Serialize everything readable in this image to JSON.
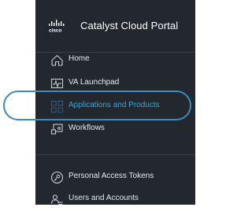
{
  "brand": {
    "logo_text": "cisco",
    "title": "Catalyst Cloud Portal"
  },
  "nav": {
    "items": [
      {
        "label": "Home",
        "icon": "home-icon"
      },
      {
        "label": "VA Launchpad",
        "icon": "pulse-monitor-icon"
      },
      {
        "label": "Applications and Products",
        "icon": "grid-icon",
        "active": true
      },
      {
        "label": "Workflows",
        "icon": "workflow-icon"
      }
    ],
    "bottom_items": [
      {
        "label": "Personal Access Tokens",
        "icon": "key-icon"
      },
      {
        "label": "Users and Accounts",
        "icon": "users-icon"
      }
    ]
  },
  "colors": {
    "sidebar_bg": "#23282f",
    "active_text": "#2fa7dd",
    "highlight_ring": "#3c8ac2"
  }
}
